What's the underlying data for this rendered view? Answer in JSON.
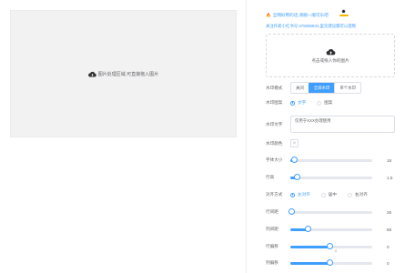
{
  "preview": {
    "hint": "图片处理区域,可直接拖入图片"
  },
  "notice": {
    "text": "全网好用的话,请顺一顺可乐吧",
    "badge_icon": "sponsor-badge-icon"
  },
  "author_line": "关注作者小红书号:475086834,里克建议都可以提哦",
  "upload": {
    "text": "点击或拖入你的图片"
  },
  "form": {
    "mode": {
      "label": "水印模式",
      "options": [
        "关闭",
        "全屏水印",
        "单个水印"
      ],
      "selected": "全屏水印"
    },
    "type": {
      "label": "水印图案",
      "options": [
        "文字",
        "图案"
      ],
      "selected": "文字"
    },
    "text": {
      "label": "水印文字",
      "value": "仅用于XXX办理使用"
    },
    "color": {
      "label": "水印颜色"
    },
    "font_size": {
      "label": "字体大小",
      "value": "18",
      "fraction": 0.05
    },
    "line_height": {
      "label": "行高",
      "value": "1.5",
      "fraction": 0.08
    },
    "align": {
      "label": "对齐方式",
      "options": [
        "左对齐",
        "居中",
        "右对齐"
      ],
      "selected": "左对齐"
    },
    "row_gap": {
      "label": "行间距",
      "value": "28",
      "fraction": 0.02
    },
    "col_gap": {
      "label": "列间距",
      "value": "88",
      "fraction": 0.22
    },
    "row_offset": {
      "label": "行偏移",
      "value": "0",
      "fraction": 0.48,
      "tick": "0"
    },
    "col_offset": {
      "label": "列偏移",
      "value": "0",
      "fraction": 0.48
    }
  },
  "colors": {
    "accent": "#409eff",
    "notice": "#f56c6c"
  }
}
